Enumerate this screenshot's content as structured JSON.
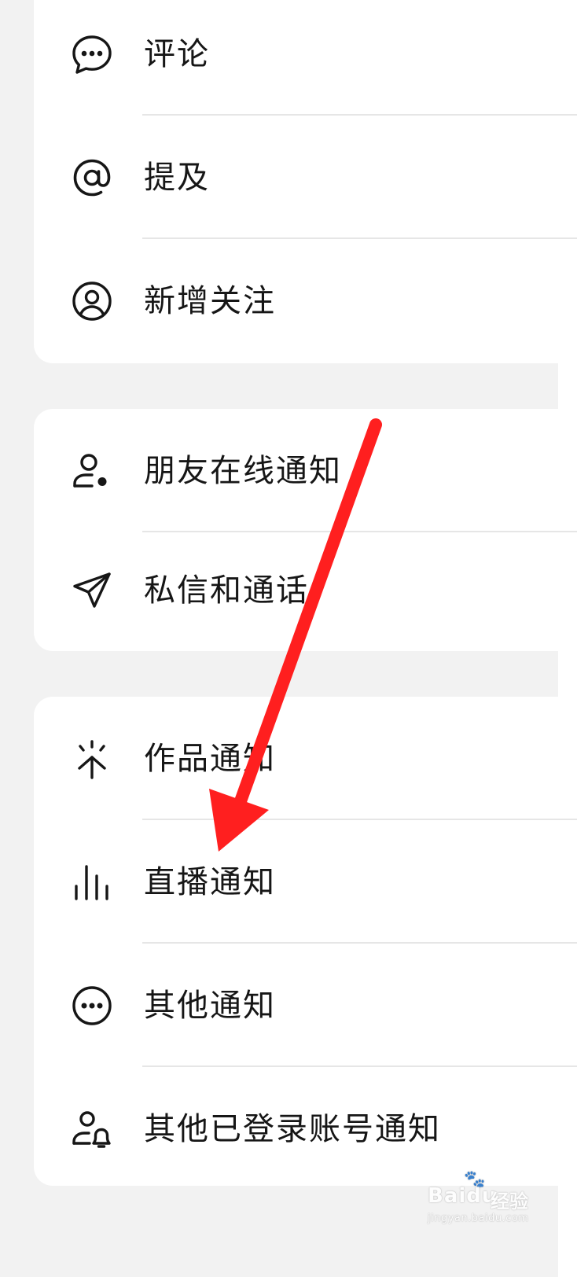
{
  "groups": [
    {
      "items": [
        {
          "label": "评论",
          "icon": "comment-icon"
        },
        {
          "label": "提及",
          "icon": "at-mention-icon"
        },
        {
          "label": "新增关注",
          "icon": "new-follower-icon"
        }
      ]
    },
    {
      "items": [
        {
          "label": "朋友在线通知",
          "icon": "friend-online-icon"
        },
        {
          "label": "私信和通话",
          "icon": "send-message-icon"
        }
      ]
    },
    {
      "items": [
        {
          "label": "作品通知",
          "icon": "works-sparkle-icon"
        },
        {
          "label": "直播通知",
          "icon": "live-bars-icon"
        },
        {
          "label": "其他通知",
          "icon": "more-circle-icon"
        },
        {
          "label": "其他已登录账号通知",
          "icon": "account-bell-icon"
        }
      ]
    }
  ],
  "annotation": {
    "color": "#ff1f1f",
    "target": "直播通知"
  },
  "watermark": {
    "brand": "Baidu",
    "suffix": "经验",
    "url": "jingyan.baidu.com"
  }
}
